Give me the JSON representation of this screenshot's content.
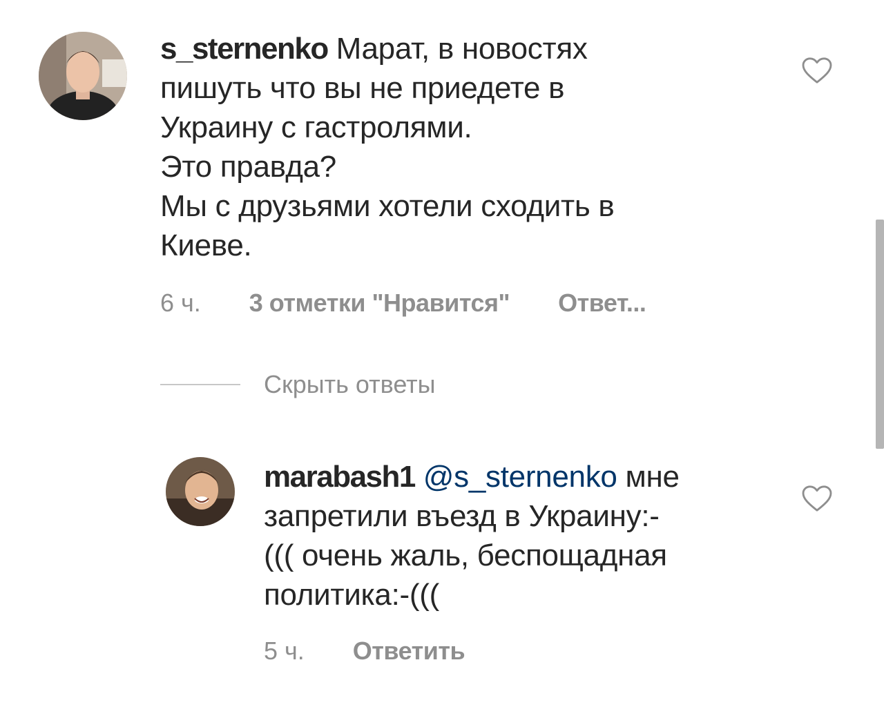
{
  "comments": [
    {
      "username": "s_sternenko",
      "lines": [
        " Марат, в новостях",
        "пишуть что вы не приедете в",
        "Украину с гастролями.",
        "Это правда?",
        "Мы с друзьями хотели сходить в",
        "Киеве."
      ],
      "time": "6 ч.",
      "likes": "3 отметки \"Нравится\"",
      "reply": "Ответ...",
      "avatar": "avatar-photo"
    },
    {
      "username": "marabash1",
      "mention": "@s_sternenko",
      "lines": [
        " мне",
        "запретили въезд в Украину:-",
        "((( очень жаль, беспощадная",
        "политика:-((("
      ],
      "time": "5 ч.",
      "reply": "Ответить",
      "avatar": "avatar-photo"
    }
  ],
  "thread": {
    "hide_replies": "Скрыть ответы"
  },
  "icons": {
    "like": "heart-icon"
  },
  "colors": {
    "text": "#262626",
    "muted": "#8e8e8e",
    "mention": "#003569",
    "heart_stroke": "#8e8e8e"
  }
}
